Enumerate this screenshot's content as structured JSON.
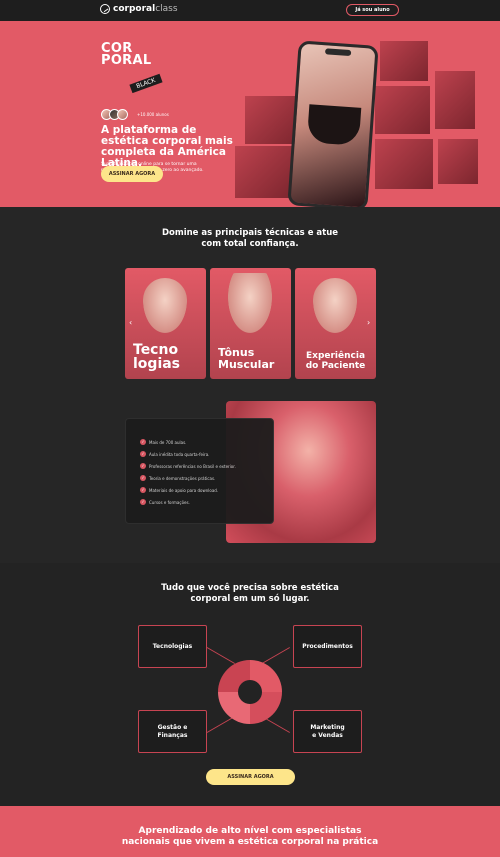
{
  "topbar": {
    "logo_bold": "corporal",
    "logo_light": "class",
    "student_button": "Já sou aluno"
  },
  "hero": {
    "brand_line1": "COR",
    "brand_line2": "PORAL",
    "brand_tag": "BLACK",
    "students_count": "+10.000 alunos",
    "title": "A plataforma de estética corporal mais completa da América Latina.",
    "subtitle": "Sua atualização online para se tornar uma referência no mercado. Do zero ao avançado.",
    "cta": "ASSINAR AGORA"
  },
  "techniques": {
    "title": "Domine as principais técnicas e atue com total confiança.",
    "cards": [
      {
        "label": "Tecno logias"
      },
      {
        "label": "Tônus Muscular"
      },
      {
        "label": "Experiência do Paciente"
      }
    ],
    "prev_arrow": "‹",
    "next_arrow": "›"
  },
  "features": {
    "items": [
      "Mais de 700 aulas.",
      "Aula inédita toda quarta-feira.",
      "Professoras referências no Brasil e exterior.",
      "Teoria e demonstrações práticas.",
      "Materiais de apoio para download.",
      "Cursos e formações."
    ]
  },
  "topics": {
    "title": "Tudo que você precisa sobre estética corporal em um só lugar.",
    "nodes": [
      "Tecnologias",
      "Procedimentos",
      "Gestão e Finanças",
      "Marketing e Vendas"
    ],
    "cta": "ASSINAR AGORA"
  },
  "experts": {
    "title": "Aprendizado de alto nível com especialistas nacionais que vivem a estética corporal na prática"
  },
  "colors": {
    "accent": "#e25a66",
    "dark": "#262626",
    "button_yellow": "#fde58a"
  }
}
